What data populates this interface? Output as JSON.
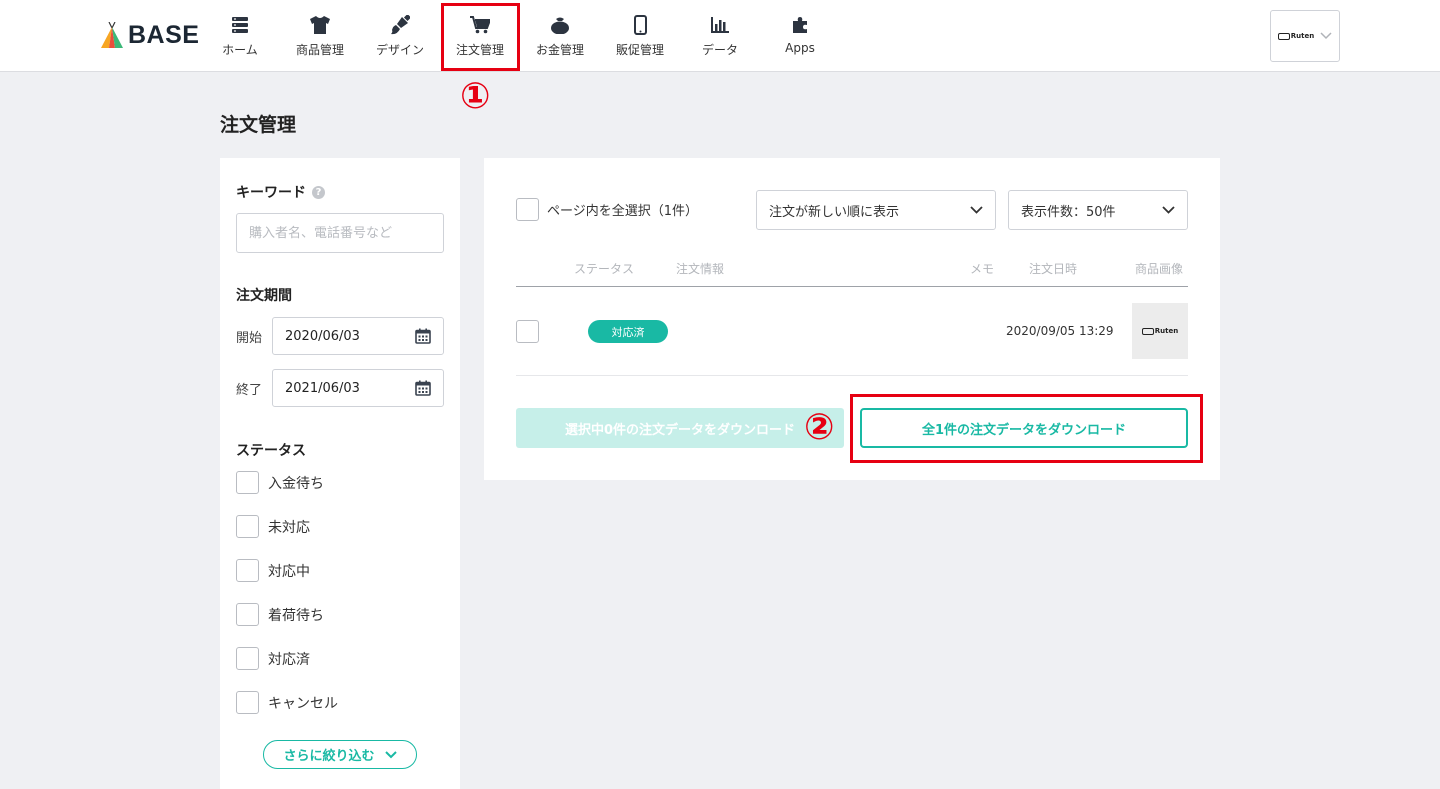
{
  "brand": {
    "name": "BASE"
  },
  "nav": {
    "items": [
      {
        "label": "ホーム",
        "icon": "server-icon"
      },
      {
        "label": "商品管理",
        "icon": "tshirt-icon"
      },
      {
        "label": "デザイン",
        "icon": "brush-icon"
      },
      {
        "label": "注文管理",
        "icon": "cart-icon"
      },
      {
        "label": "お金管理",
        "icon": "money-bag-icon"
      },
      {
        "label": "販促管理",
        "icon": "smartphone-icon"
      },
      {
        "label": "データ",
        "icon": "bar-chart-icon"
      },
      {
        "label": "Apps",
        "icon": "puzzle-icon"
      }
    ],
    "active": "注文管理"
  },
  "shop_switcher": {
    "logo_text": "Ruten"
  },
  "annotations": {
    "step1": "①",
    "step2": "②",
    "highlight_color": "#e60012"
  },
  "page": {
    "title": "注文管理"
  },
  "filters": {
    "keyword_label": "キーワード",
    "keyword_placeholder": "購入者名、電話番号など",
    "period_label": "注文期間",
    "start_label": "開始",
    "start_value": "2020/06/03",
    "end_label": "終了",
    "end_value": "2021/06/03",
    "status_label": "ステータス",
    "statuses": [
      "入金待ち",
      "未対応",
      "対応中",
      "着荷待ち",
      "対応済",
      "キャンセル"
    ],
    "more_label": "さらに絞り込む"
  },
  "orders": {
    "select_all_label": "ページ内を全選択（1件）",
    "sort_value": "注文が新しい順に表示",
    "per_page_value": "表示件数：50件",
    "columns": [
      "ステータス",
      "注文情報",
      "メモ",
      "注文日時",
      "商品画像"
    ],
    "rows": [
      {
        "status": "対応済",
        "info": "",
        "memo": "",
        "date": "2020/09/05 13:29",
        "image_logo": "Ruten"
      }
    ],
    "download_selected_label": "選択中0件の注文データをダウンロード",
    "download_all_label": "全1件の注文データをダウンロード"
  },
  "colors": {
    "accent": "#19b9a4",
    "accent_light": "#c6efe9",
    "background": "#eff0f3"
  }
}
